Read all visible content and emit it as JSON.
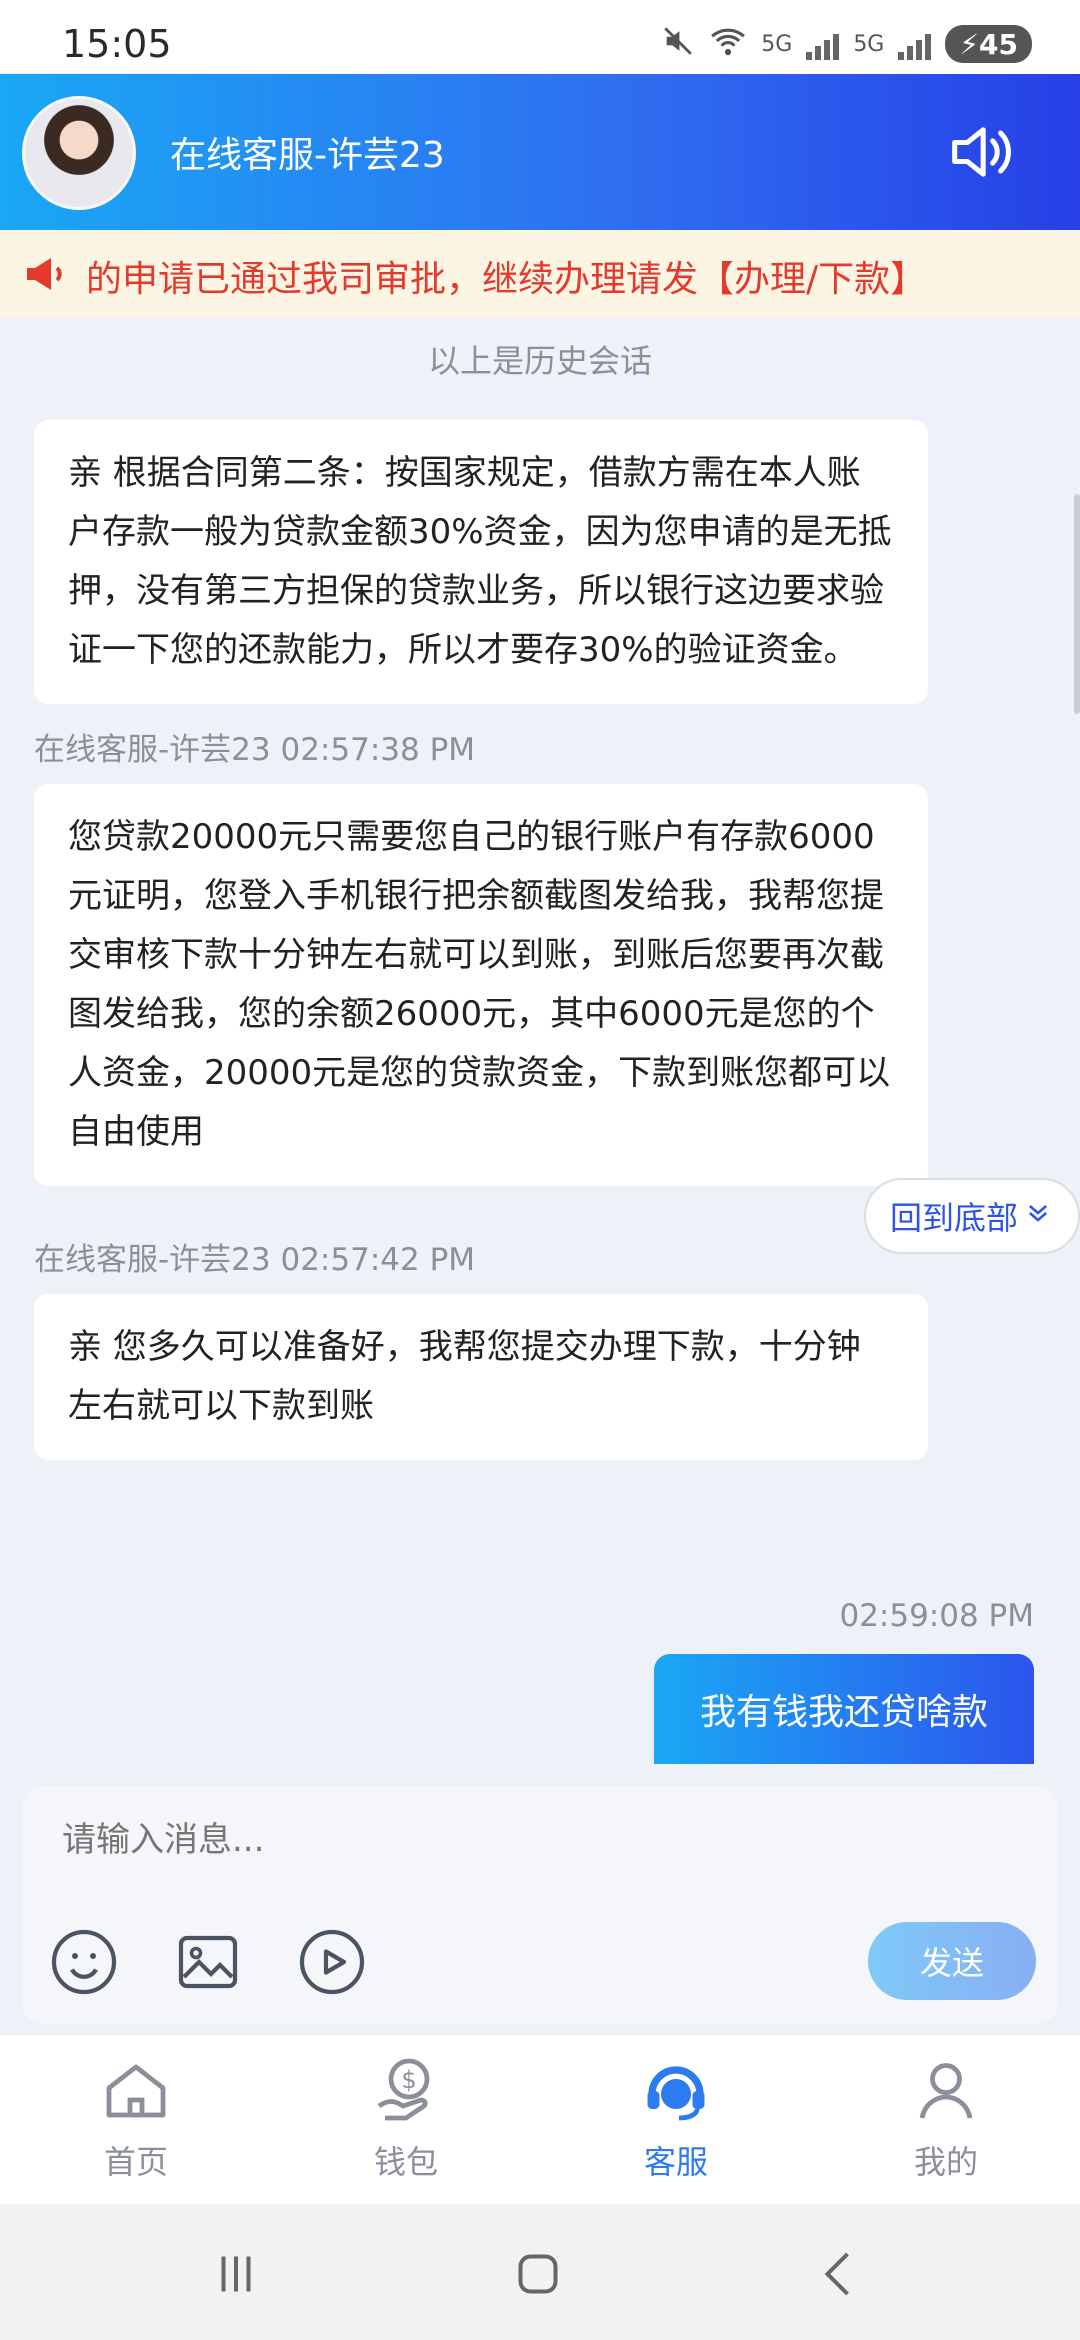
{
  "status": {
    "time": "15:05",
    "net1": "5G",
    "net2": "5G",
    "battery": "45"
  },
  "header": {
    "title": "在线客服-许芸23"
  },
  "notice": {
    "text": "的申请已通过我司审批，继续办理请发【办理/下款】"
  },
  "chat": {
    "history_label": "以上是历史会话",
    "messages": [
      {
        "text": "亲   根据合同第二条：按国家规定，借款方需在本人账户存款一般为贷款金额30%资金，因为您申请的是无抵押，没有第三方担保的贷款业务，所以银行这边要求验证一下您的还款能力，所以才要存30%的验证资金。"
      },
      {
        "meta": "在线客服-许芸23 02:57:38 PM",
        "text": "您贷款20000元只需要您自己的银行账户有存款6000元证明，您登入手机银行把余额截图发给我，我帮您提交审核下款十分钟左右就可以到账，到账后您要再次截图发给我，您的余额26000元，其中6000元是您的个人资金，20000元是您的贷款资金，下款到账您都可以自由使用"
      },
      {
        "meta": "在线客服-许芸23 02:57:42 PM",
        "text": "亲 您多久可以准备好，我帮您提交办理下款，十分钟左右就可以下款到账"
      },
      {
        "meta": "02:59:08 PM",
        "text": "我有钱我还贷啥款"
      }
    ],
    "back_to_bottom": "回到底部"
  },
  "composer": {
    "placeholder": "请输入消息...",
    "send_label": "发送",
    "tools": [
      "emoji-icon",
      "image-icon",
      "video-icon"
    ]
  },
  "tabbar": {
    "tabs": [
      {
        "label": "首页",
        "icon": "home-icon"
      },
      {
        "label": "钱包",
        "icon": "wallet-icon"
      },
      {
        "label": "客服",
        "icon": "customer-service-icon",
        "active": true
      },
      {
        "label": "我的",
        "icon": "profile-icon"
      }
    ]
  },
  "colors": {
    "header_start": "#1aa8f5",
    "header_end": "#2640e6",
    "notice_text": "#e23a2d",
    "active_tab": "#2c7cf0"
  }
}
